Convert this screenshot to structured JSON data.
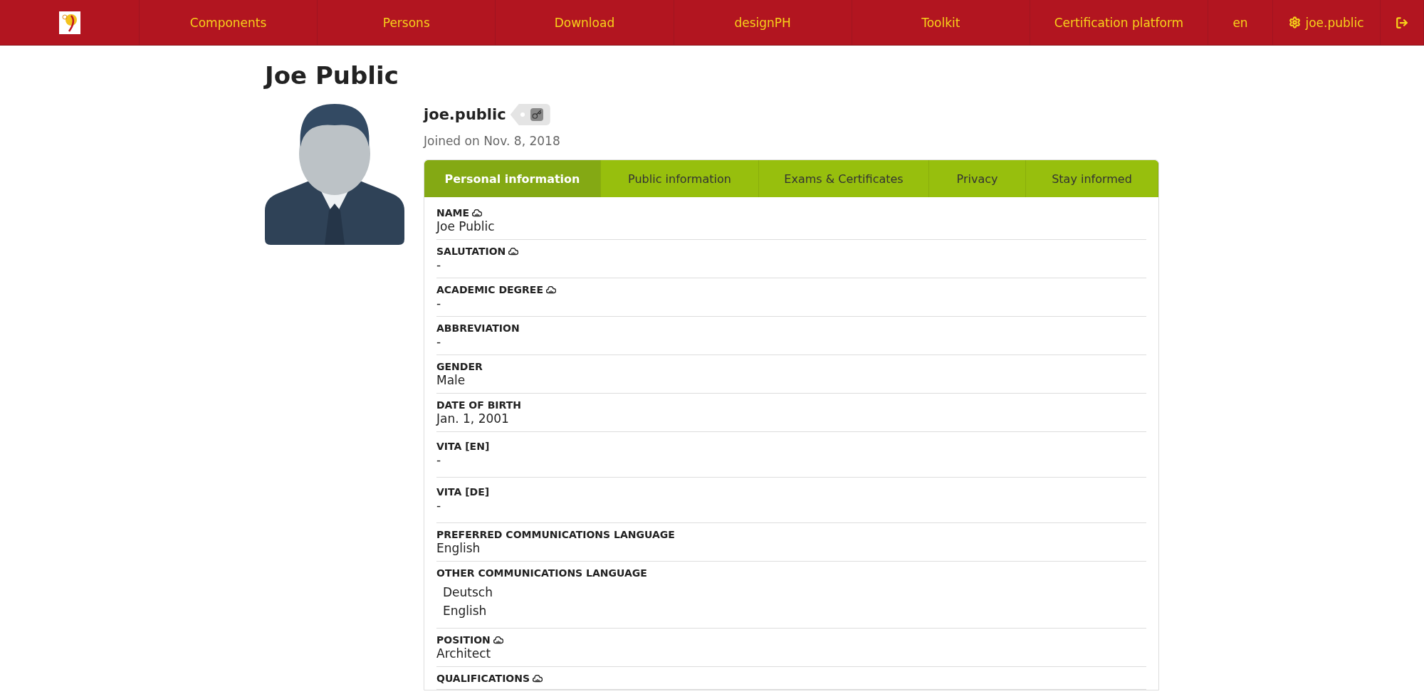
{
  "nav": {
    "items": [
      {
        "label": "Components"
      },
      {
        "label": "Persons"
      },
      {
        "label": "Download"
      },
      {
        "label": "designPH"
      },
      {
        "label": "Toolkit"
      },
      {
        "label": "Certification platform"
      }
    ],
    "language": "en",
    "user": "joe.public"
  },
  "page_title": "Joe Public",
  "profile": {
    "username": "joe.public",
    "joined": "Joined on Nov. 8, 2018"
  },
  "tabs": [
    {
      "label": "Personal information",
      "selected": true
    },
    {
      "label": "Public information",
      "selected": false
    },
    {
      "label": "Exams & Certificates",
      "selected": false
    },
    {
      "label": "Privacy",
      "selected": false
    },
    {
      "label": "Stay informed",
      "selected": false
    }
  ],
  "fields": [
    {
      "label": "NAME",
      "public": true,
      "values": [
        "Joe Public"
      ]
    },
    {
      "label": "SALUTATION",
      "public": true,
      "values": [
        "-"
      ]
    },
    {
      "label": "ACADEMIC DEGREE",
      "public": true,
      "values": [
        "-"
      ]
    },
    {
      "label": "ABBREVIATION",
      "public": false,
      "values": [
        "-"
      ]
    },
    {
      "label": "GENDER",
      "public": false,
      "values": [
        "Male"
      ]
    },
    {
      "label": "DATE OF BIRTH",
      "public": false,
      "values": [
        "Jan. 1, 2001"
      ]
    },
    {
      "label": "VITA [EN]",
      "public": false,
      "kind": "long",
      "values": [
        "-"
      ]
    },
    {
      "label": "VITA [DE]",
      "public": false,
      "kind": "long",
      "values": [
        "-"
      ]
    },
    {
      "label": "PREFERRED COMMUNICATIONS LANGUAGE",
      "public": false,
      "values": [
        "English"
      ]
    },
    {
      "label": "OTHER COMMUNICATIONS LANGUAGE",
      "public": false,
      "kind": "list",
      "values": [
        "Deutsch",
        "English"
      ]
    },
    {
      "label": "POSITION",
      "public": true,
      "values": [
        "Architect"
      ]
    },
    {
      "label": "QUALIFICATIONS",
      "public": true
    }
  ]
}
